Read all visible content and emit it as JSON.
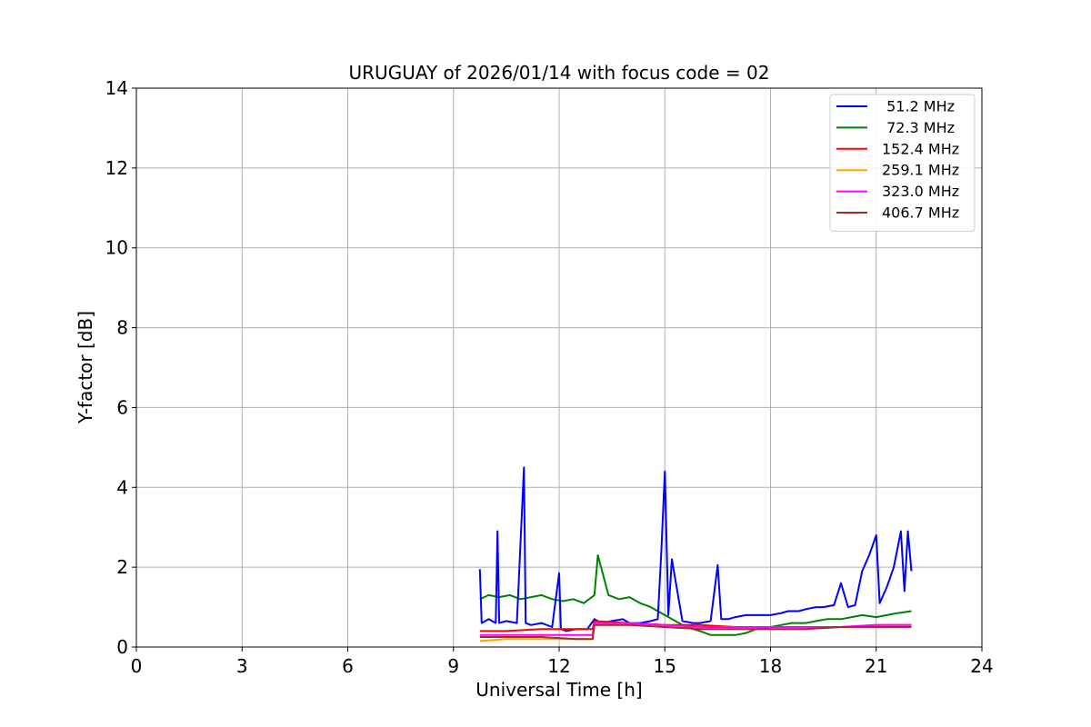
{
  "chart_data": {
    "type": "line",
    "title": "URUGUAY of 2026/01/14 with focus code = 02",
    "xlabel": "Universal Time [h]",
    "ylabel": "Y-factor [dB]",
    "xlim": [
      0,
      24
    ],
    "ylim": [
      0,
      14
    ],
    "xticks": [
      0,
      3,
      6,
      9,
      12,
      15,
      18,
      21,
      24
    ],
    "yticks": [
      0,
      2,
      4,
      6,
      8,
      10,
      12,
      14
    ],
    "grid": true,
    "legend_position": "top-right",
    "series": [
      {
        "name": " 51.2 MHz",
        "color": "#0000ff",
        "x": [
          9.75,
          9.8,
          10.0,
          10.2,
          10.25,
          10.3,
          10.5,
          10.8,
          11.0,
          11.05,
          11.2,
          11.5,
          11.8,
          12.0,
          12.05,
          12.2,
          12.5,
          12.8,
          13.0,
          13.2,
          13.5,
          13.8,
          14.0,
          14.3,
          14.6,
          14.8,
          14.9,
          15.0,
          15.1,
          15.2,
          15.5,
          15.8,
          16.0,
          16.3,
          16.5,
          16.6,
          16.8,
          17.0,
          17.3,
          17.5,
          17.8,
          18.0,
          18.3,
          18.5,
          18.8,
          19.0,
          19.3,
          19.5,
          19.8,
          20.0,
          20.2,
          20.4,
          20.6,
          20.8,
          21.0,
          21.1,
          21.3,
          21.5,
          21.7,
          21.8,
          21.9,
          22.0
        ],
        "y": [
          1.95,
          0.6,
          0.7,
          0.6,
          2.9,
          0.6,
          0.65,
          0.6,
          4.5,
          0.6,
          0.55,
          0.6,
          0.5,
          1.85,
          0.45,
          0.4,
          0.45,
          0.45,
          0.7,
          0.6,
          0.65,
          0.7,
          0.6,
          0.6,
          0.65,
          0.7,
          2.4,
          4.4,
          0.8,
          2.2,
          0.65,
          0.6,
          0.6,
          0.65,
          2.05,
          0.7,
          0.7,
          0.75,
          0.8,
          0.8,
          0.8,
          0.8,
          0.85,
          0.9,
          0.9,
          0.95,
          1.0,
          1.0,
          1.05,
          1.6,
          1.0,
          1.05,
          1.9,
          2.3,
          2.8,
          1.1,
          1.5,
          2.0,
          2.9,
          1.4,
          2.9,
          1.9
        ]
      },
      {
        "name": " 72.3 MHz",
        "color": "#008000",
        "x": [
          9.75,
          10.0,
          10.3,
          10.6,
          10.9,
          11.2,
          11.5,
          11.8,
          12.1,
          12.4,
          12.7,
          13.0,
          13.1,
          13.4,
          13.7,
          14.0,
          14.3,
          14.6,
          15.0,
          15.3,
          15.6,
          16.0,
          16.3,
          16.6,
          17.0,
          17.3,
          17.6,
          18.0,
          18.3,
          18.6,
          19.0,
          19.3,
          19.6,
          20.0,
          20.3,
          20.6,
          21.0,
          21.3,
          21.6,
          22.0
        ],
        "y": [
          1.2,
          1.3,
          1.25,
          1.3,
          1.2,
          1.25,
          1.3,
          1.2,
          1.15,
          1.2,
          1.1,
          1.3,
          2.3,
          1.3,
          1.2,
          1.25,
          1.1,
          1.0,
          0.8,
          0.65,
          0.5,
          0.4,
          0.3,
          0.3,
          0.3,
          0.35,
          0.45,
          0.5,
          0.55,
          0.6,
          0.6,
          0.65,
          0.7,
          0.7,
          0.75,
          0.8,
          0.75,
          0.8,
          0.85,
          0.9
        ]
      },
      {
        "name": "152.4 MHz",
        "color": "#ff0000",
        "x": [
          9.75,
          10.5,
          11.5,
          12.5,
          12.95,
          13.0,
          14.0,
          15.0,
          16.0,
          17.0,
          18.0,
          19.0,
          20.0,
          21.0,
          22.0
        ],
        "y": [
          0.4,
          0.4,
          0.45,
          0.45,
          0.45,
          0.65,
          0.6,
          0.55,
          0.55,
          0.5,
          0.5,
          0.5,
          0.5,
          0.55,
          0.55
        ]
      },
      {
        "name": "259.1 MHz",
        "color": "#ffa500",
        "x": [
          9.75,
          10.5,
          11.5,
          12.5,
          12.95,
          13.0,
          14.0,
          15.0,
          16.0,
          17.0,
          18.0,
          19.0,
          20.0,
          21.0,
          22.0
        ],
        "y": [
          0.15,
          0.2,
          0.2,
          0.2,
          0.2,
          0.55,
          0.55,
          0.5,
          0.45,
          0.45,
          0.45,
          0.45,
          0.5,
          0.5,
          0.5
        ]
      },
      {
        "name": "323.0 MHz",
        "color": "#ff00ff",
        "x": [
          9.75,
          10.5,
          11.5,
          12.5,
          12.95,
          13.0,
          14.0,
          15.0,
          16.0,
          17.0,
          18.0,
          19.0,
          20.0,
          21.0,
          22.0
        ],
        "y": [
          0.3,
          0.3,
          0.3,
          0.3,
          0.3,
          0.6,
          0.6,
          0.55,
          0.5,
          0.5,
          0.5,
          0.5,
          0.5,
          0.55,
          0.55
        ]
      },
      {
        "name": "406.7 MHz",
        "color": "#a52a2a",
        "x": [
          9.75,
          10.5,
          11.5,
          12.5,
          12.95,
          13.0,
          14.0,
          15.0,
          16.0,
          17.0,
          18.0,
          19.0,
          20.0,
          21.0,
          22.0
        ],
        "y": [
          0.25,
          0.25,
          0.25,
          0.2,
          0.2,
          0.55,
          0.55,
          0.5,
          0.45,
          0.45,
          0.45,
          0.45,
          0.5,
          0.5,
          0.5
        ]
      }
    ]
  }
}
